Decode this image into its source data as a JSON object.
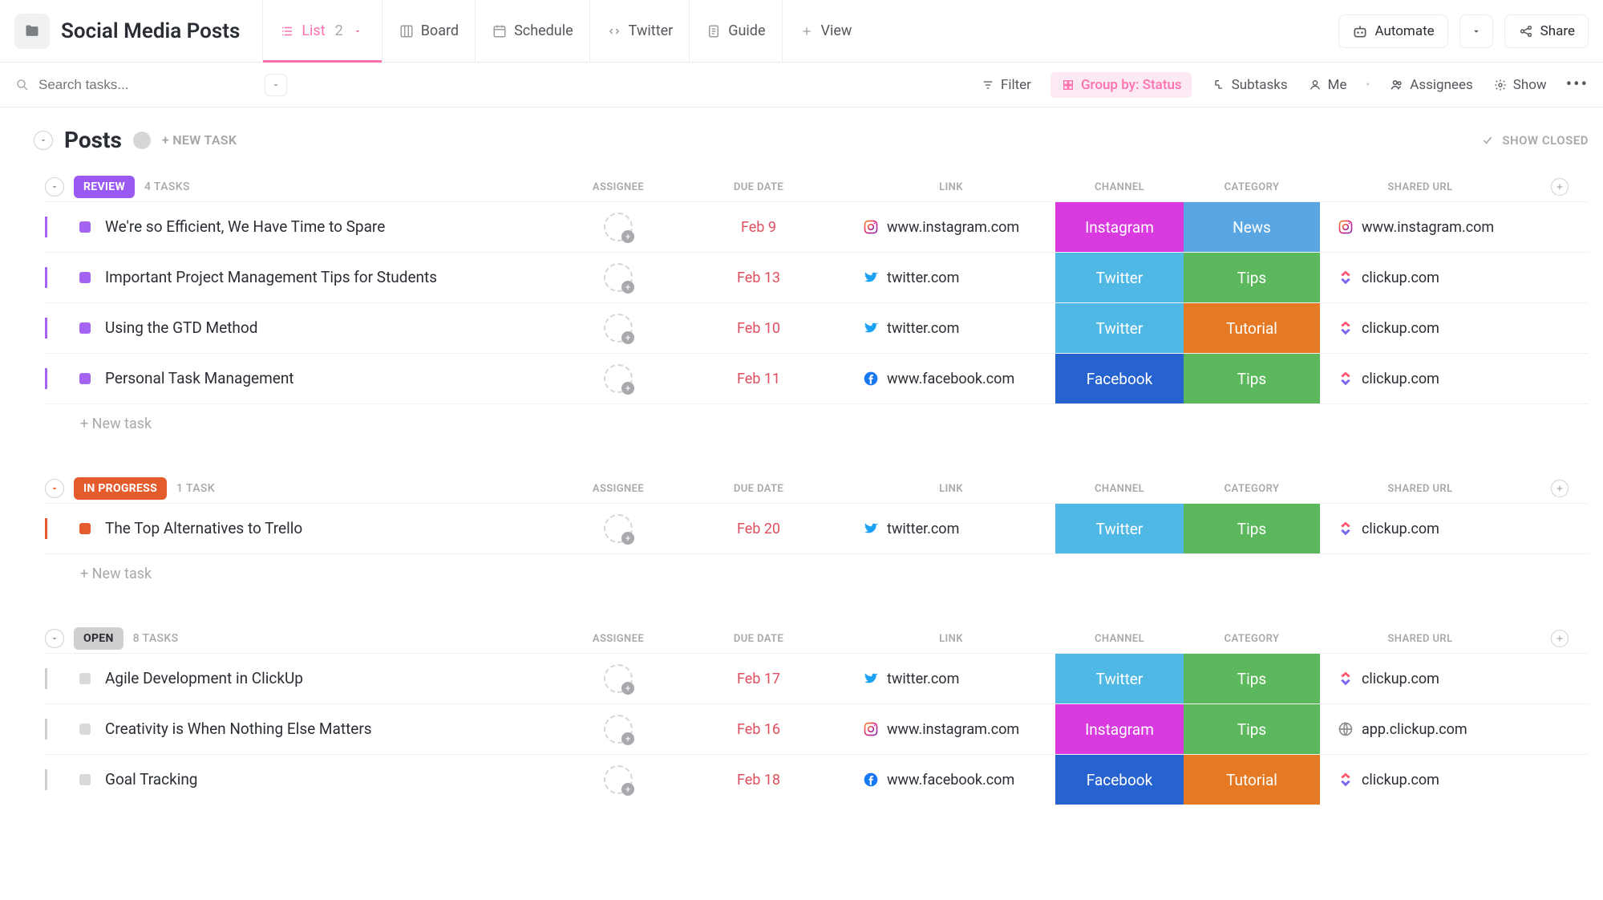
{
  "page": {
    "title": "Social Media Posts"
  },
  "views": {
    "list": {
      "label": "List",
      "count": "2"
    },
    "board": {
      "label": "Board"
    },
    "schedule": {
      "label": "Schedule"
    },
    "twitter": {
      "label": "Twitter"
    },
    "guide": {
      "label": "Guide"
    },
    "add": {
      "label": "View"
    }
  },
  "topbar_right": {
    "automate": "Automate",
    "share": "Share"
  },
  "toolbar2": {
    "search_placeholder": "Search tasks...",
    "filter": "Filter",
    "groupby": "Group by: Status",
    "subtasks": "Subtasks",
    "me": "Me",
    "assignees": "Assignees",
    "show": "Show"
  },
  "posts_header": {
    "title": "Posts",
    "newtask": "+ NEW TASK",
    "show_closed": "SHOW CLOSED"
  },
  "columns": {
    "assignee": "ASSIGNEE",
    "due": "DUE DATE",
    "link": "LINK",
    "channel": "CHANNEL",
    "category": "CATEGORY",
    "shared": "SHARED URL"
  },
  "groups": [
    {
      "id": "review",
      "label": "REVIEW",
      "count_label": "4 TASKS",
      "bg": "c-review",
      "sq": "sq-review",
      "border": "review-border",
      "tasks": [
        {
          "title": "We're so Efficient, We Have Time to Spare",
          "due": "Feb 9",
          "link_site": "instagram",
          "link_text": "www.instagram.com",
          "channel": "Instagram",
          "channel_cls": "ch-instagram",
          "category": "News",
          "category_cls": "cat-news",
          "shared_site": "instagram",
          "shared_text": "www.instagram.com"
        },
        {
          "title": "Important Project Management Tips for Students",
          "due": "Feb 13",
          "link_site": "twitter",
          "link_text": "twitter.com",
          "channel": "Twitter",
          "channel_cls": "ch-twitter",
          "category": "Tips",
          "category_cls": "cat-tips",
          "shared_site": "clickup",
          "shared_text": "clickup.com"
        },
        {
          "title": "Using the GTD Method",
          "due": "Feb 10",
          "link_site": "twitter",
          "link_text": "twitter.com",
          "channel": "Twitter",
          "channel_cls": "ch-twitter",
          "category": "Tutorial",
          "category_cls": "cat-tutorial",
          "shared_site": "clickup",
          "shared_text": "clickup.com"
        },
        {
          "title": "Personal Task Management",
          "due": "Feb 11",
          "link_site": "facebook",
          "link_text": "www.facebook.com",
          "channel": "Facebook",
          "channel_cls": "ch-facebook",
          "category": "Tips",
          "category_cls": "cat-tips",
          "shared_site": "clickup",
          "shared_text": "clickup.com"
        }
      ]
    },
    {
      "id": "in-progress",
      "label": "IN PROGRESS",
      "count_label": "1 TASK",
      "bg": "c-progress",
      "sq": "sq-progress",
      "border": "progress-border",
      "tasks": [
        {
          "title": "The Top Alternatives to Trello",
          "due": "Feb 20",
          "link_site": "twitter",
          "link_text": "twitter.com",
          "channel": "Twitter",
          "channel_cls": "ch-twitter",
          "category": "Tips",
          "category_cls": "cat-tips",
          "shared_site": "clickup",
          "shared_text": "clickup.com"
        }
      ]
    },
    {
      "id": "open",
      "label": "OPEN",
      "count_label": "8 TASKS",
      "bg": "c-open",
      "sq": "sq-open",
      "border": "open-border",
      "tasks": [
        {
          "title": "Agile Development in ClickUp",
          "due": "Feb 17",
          "link_site": "twitter",
          "link_text": "twitter.com",
          "channel": "Twitter",
          "channel_cls": "ch-twitter",
          "category": "Tips",
          "category_cls": "cat-tips",
          "shared_site": "clickup",
          "shared_text": "clickup.com"
        },
        {
          "title": "Creativity is When Nothing Else Matters",
          "due": "Feb 16",
          "link_site": "instagram",
          "link_text": "www.instagram.com",
          "channel": "Instagram",
          "channel_cls": "ch-instagram",
          "category": "Tips",
          "category_cls": "cat-tips",
          "shared_site": "globe",
          "shared_text": "app.clickup.com"
        },
        {
          "title": "Goal Tracking",
          "due": "Feb 18",
          "link_site": "facebook",
          "link_text": "www.facebook.com",
          "channel": "Facebook",
          "channel_cls": "ch-facebook",
          "category": "Tutorial",
          "category_cls": "cat-tutorial",
          "shared_site": "clickup",
          "shared_text": "clickup.com"
        }
      ]
    }
  ],
  "newtask_row": "+ New task"
}
